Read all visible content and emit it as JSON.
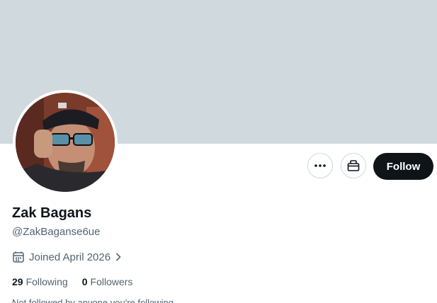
{
  "profile": {
    "name": "Zak Bagans",
    "handle": "@ZakBaganse6ue",
    "joined": "Joined April 2026",
    "not_followed_text": "Not followed by anyone you're following"
  },
  "actions": {
    "more_icon": "more-horizontal-icon",
    "gift_icon": "gift-icon",
    "follow_label": "Follow"
  },
  "stats": {
    "following_count": "29",
    "following_label": "Following",
    "followers_count": "0",
    "followers_label": "Followers"
  },
  "colors": {
    "banner": "#cfd9de",
    "follow_bg": "#0f1419",
    "secondary_text": "#536471"
  }
}
